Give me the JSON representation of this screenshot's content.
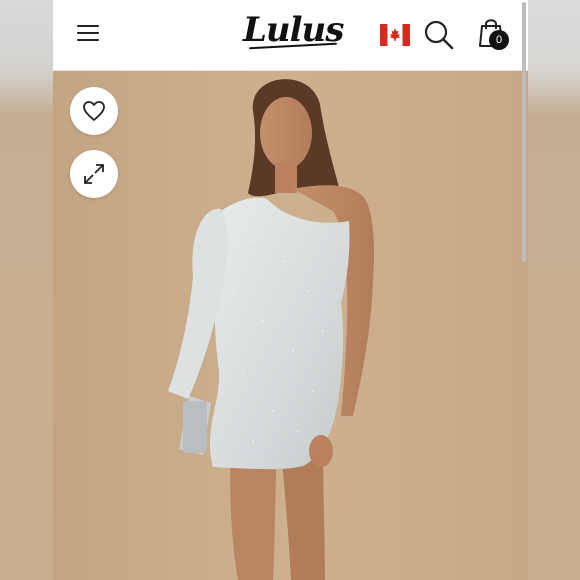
{
  "header": {
    "logo_text": "Lulus",
    "cart_count": "0",
    "country_flag": "canada-flag-icon"
  },
  "product_image": {
    "description_icon": "product-photo",
    "background_color": "#c9ad8a",
    "dress_color": "#dfe3e3"
  },
  "actions": {
    "favorite_icon": "heart-icon",
    "expand_icon": "expand-icon"
  },
  "colors": {
    "header_bg": "#ffffff",
    "accent_red": "#d52b1e",
    "icon": "#222222"
  }
}
